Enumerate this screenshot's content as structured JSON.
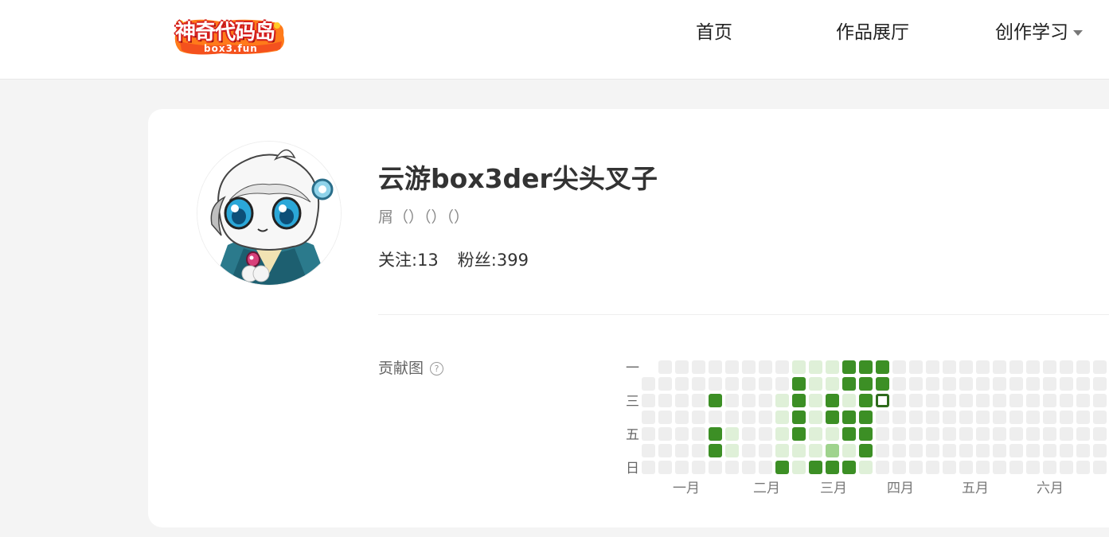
{
  "brand": {
    "logo_text": "神奇代码岛",
    "logo_sub": "box3.fun"
  },
  "nav": {
    "items": [
      {
        "label": "首页"
      },
      {
        "label": "作品展厅"
      },
      {
        "label": "创作学习"
      }
    ]
  },
  "profile": {
    "username": "云游box3der尖头叉子",
    "bio": "屑（）（）（）",
    "following": "关注:13",
    "followers": "粉丝:399"
  },
  "contrib": {
    "label": "贡献图",
    "help_icon": "help-circle-icon",
    "weekday_labels": [
      "一",
      "三",
      "五",
      "日"
    ],
    "month_labels": [
      "一月",
      "二月",
      "三月",
      "四月",
      "五月",
      "六月"
    ],
    "colors": {
      "empty": "#eeeeee",
      "l1": "#dff0d8",
      "l2": "#9fd38d",
      "l3": "#3c8f25"
    },
    "first_week_offset_days": 1,
    "selected_cell": {
      "week": 14,
      "day": 2
    },
    "weeks": [
      [
        0,
        0,
        0,
        0,
        0,
        0
      ],
      [
        0,
        0,
        0,
        0,
        0,
        0,
        0
      ],
      [
        0,
        0,
        0,
        0,
        0,
        0,
        0
      ],
      [
        0,
        0,
        0,
        0,
        0,
        0,
        0
      ],
      [
        0,
        0,
        3,
        0,
        3,
        3,
        0
      ],
      [
        0,
        0,
        0,
        0,
        1,
        1,
        0
      ],
      [
        0,
        0,
        0,
        0,
        0,
        0,
        0
      ],
      [
        0,
        0,
        0,
        0,
        0,
        0,
        0
      ],
      [
        0,
        0,
        1,
        1,
        1,
        1,
        3
      ],
      [
        1,
        3,
        3,
        3,
        3,
        1,
        1
      ],
      [
        1,
        1,
        1,
        1,
        1,
        1,
        3
      ],
      [
        1,
        1,
        3,
        3,
        1,
        2,
        3
      ],
      [
        3,
        3,
        1,
        3,
        3,
        1,
        3
      ],
      [
        3,
        3,
        3,
        3,
        3,
        3,
        1
      ],
      [
        3,
        3,
        0,
        0,
        0,
        0,
        0
      ],
      [
        0,
        0,
        0,
        0,
        0,
        0,
        0
      ],
      [
        0,
        0,
        0,
        0,
        0,
        0,
        0
      ],
      [
        0,
        0,
        0,
        0,
        0,
        0,
        0
      ],
      [
        0,
        0,
        0,
        0,
        0,
        0,
        0
      ],
      [
        0,
        0,
        0,
        0,
        0,
        0,
        0
      ],
      [
        0,
        0,
        0,
        0,
        0,
        0,
        0
      ],
      [
        0,
        0,
        0,
        0,
        0,
        0,
        0
      ],
      [
        0,
        0,
        0,
        0,
        0,
        0,
        0
      ],
      [
        0,
        0,
        0,
        0,
        0,
        0,
        0
      ],
      [
        0,
        0,
        0,
        0,
        0,
        0,
        0
      ],
      [
        0,
        0,
        0,
        0,
        0,
        0,
        0
      ],
      [
        0,
        0,
        0,
        0,
        0,
        0,
        0
      ],
      [
        0,
        0,
        0,
        0,
        0,
        0,
        0
      ]
    ]
  }
}
